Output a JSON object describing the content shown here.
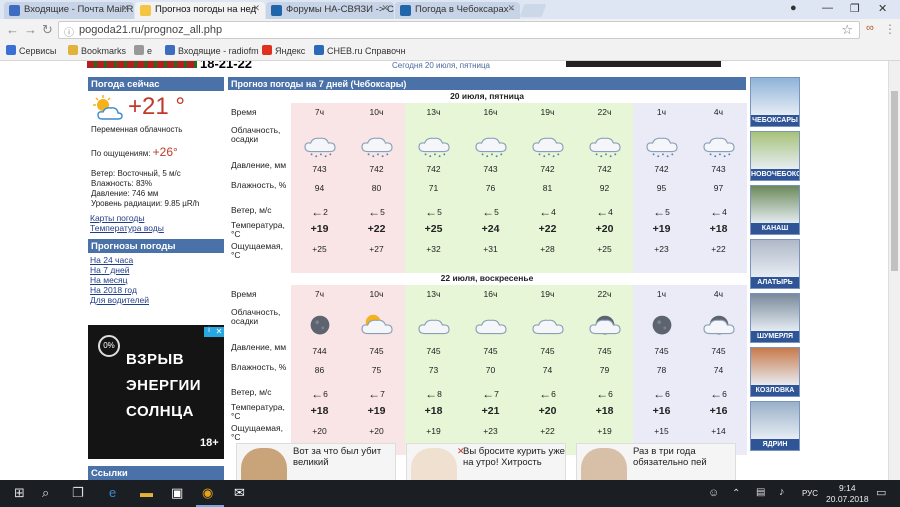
{
  "browser": {
    "tabs": [
      {
        "label": "Входящие - Почта Mail.R",
        "color": "#3d6cc0"
      },
      {
        "label": "Прогноз погоды на нед",
        "color": "#f4c542",
        "active": true
      },
      {
        "label": "Форумы НА-СВЯЗИ -> С",
        "color": "#2266aa"
      },
      {
        "label": "Погода в Чебоксарах -",
        "color": "#2266aa"
      }
    ],
    "url": "pogoda21.ru/prognoz_all.php",
    "bookmarks": [
      "Сервисы",
      "Bookmarks",
      "e",
      "Входящие - radiofm",
      "Яндекс",
      "CHEB.ru Справочн"
    ]
  },
  "banner": {
    "date_big": "18-21-22",
    "date_small": "Сегодня 20 июля, пятница"
  },
  "left": {
    "now_title": "Погода сейчас",
    "temp": "+21 °",
    "condition": "Переменная облачность",
    "feels_label": "По ощущениям:",
    "feels_value": "+26°",
    "wind": "Ветер: Восточный, 5 м/с",
    "humidity": "Влажность: 83%",
    "pressure": "Давление: 746 мм",
    "radiation": "Уровень радиации: 9.85 µR/h",
    "links1": [
      "Карты погоды",
      "Температура воды"
    ],
    "forecast_title": "Прогнозы погоды",
    "links2": [
      "На 24 часа",
      "На 7 дней",
      "На месяц",
      "На 2018 год",
      "Для водителей"
    ],
    "ad_lines": [
      "ВЗРЫВ",
      "ЭНЕРГИИ",
      "СОЛНЦА"
    ],
    "ad_age": "18+",
    "ad_logo": "0%",
    "links_title": "Ссылки"
  },
  "forecast": {
    "title": "Прогноз погоды на 7 дней (Чебоксары)",
    "row_labels": {
      "time": "Время",
      "cloud": "Облачность, осадки",
      "pressure": "Давление, мм",
      "humidity": "Влажность, %",
      "wind": "Ветер, м/с",
      "temp": "Температура, °С",
      "feels": "Ощущаемая, °С"
    },
    "days": [
      {
        "date": "20 июля, пятница",
        "times": [
          "7ч",
          "10ч",
          "13ч",
          "16ч",
          "19ч",
          "22ч",
          "1ч",
          "4ч"
        ],
        "icons": [
          "cloud-rain",
          "cloud-rain",
          "cloud-rain",
          "cloud-rain",
          "cloud-rain",
          "cloud-rain",
          "cloud-rain",
          "cloud-rain"
        ],
        "pressure": [
          "743",
          "742",
          "742",
          "743",
          "742",
          "742",
          "742",
          "743"
        ],
        "humidity": [
          "94",
          "80",
          "71",
          "76",
          "81",
          "92",
          "95",
          "97"
        ],
        "wind": [
          "2",
          "5",
          "5",
          "5",
          "4",
          "4",
          "5",
          "4"
        ],
        "temp": [
          "+19",
          "+22",
          "+25",
          "+24",
          "+22",
          "+20",
          "+19",
          "+18"
        ],
        "feels": [
          "+25",
          "+27",
          "+32",
          "+31",
          "+28",
          "+25",
          "+23",
          "+22"
        ]
      },
      {
        "date": "22 июля, воскресенье",
        "times": [
          "7ч",
          "10ч",
          "13ч",
          "16ч",
          "19ч",
          "22ч",
          "1ч",
          "4ч"
        ],
        "icons": [
          "moon",
          "sun-cloud",
          "cloud",
          "cloud",
          "cloud",
          "moon-cloud",
          "moon",
          "moon-cloud"
        ],
        "pressure": [
          "744",
          "745",
          "745",
          "745",
          "745",
          "745",
          "745",
          "745"
        ],
        "humidity": [
          "86",
          "75",
          "73",
          "70",
          "74",
          "79",
          "78",
          "74"
        ],
        "wind": [
          "6",
          "7",
          "8",
          "7",
          "6",
          "6",
          "6",
          "6"
        ],
        "temp": [
          "+18",
          "+19",
          "+18",
          "+21",
          "+20",
          "+18",
          "+16",
          "+16"
        ],
        "feels": [
          "+20",
          "+20",
          "+19",
          "+23",
          "+22",
          "+19",
          "+15",
          "+14"
        ]
      }
    ],
    "col_colors": [
      "#f9e5e5",
      "#f9e5e5",
      "#e6f6d6",
      "#e6f6d6",
      "#e6f6d6",
      "#e6f6d6",
      "#ebeaf7",
      "#ebeaf7"
    ]
  },
  "news": [
    {
      "text": "Вот за что был убит великий"
    },
    {
      "text": "Вы бросите курить уже на утро! Хитрость"
    },
    {
      "text": "Раз в три года обязательно пей"
    }
  ],
  "cities": [
    "ЧЕБОКСАРЫ",
    "НОВОЧЕБОКСАРСК",
    "КАНАШ",
    "АЛАТЫРЬ",
    "ШУМЕРЛЯ",
    "КОЗЛОВКА",
    "ЯДРИН"
  ],
  "taskbar": {
    "time": "9:14",
    "date": "20.07.2018",
    "lang": "РУС"
  }
}
